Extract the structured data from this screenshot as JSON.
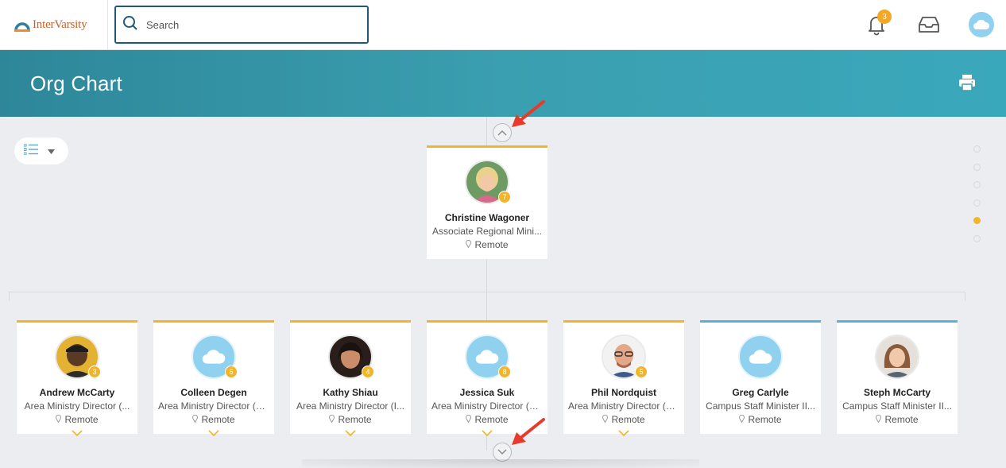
{
  "app": {
    "brand": "InterVarsity",
    "search": {
      "placeholder": "Search",
      "value": ""
    },
    "notifications": {
      "count": "3"
    }
  },
  "page": {
    "title": "Org Chart"
  },
  "manager": {
    "name": "Christine Wagoner",
    "title": "Associate Regional Mini...",
    "location": "Remote",
    "reports": "7"
  },
  "reports": [
    {
      "name": "Andrew McCarty",
      "title": "Area Ministry Director (...",
      "location": "Remote",
      "reports": "3"
    },
    {
      "name": "Colleen Degen",
      "title": "Area Ministry Director (S...",
      "location": "Remote",
      "reports": "6"
    },
    {
      "name": "Kathy Shiau",
      "title": "Area Ministry Director (I...",
      "location": "Remote",
      "reports": "4"
    },
    {
      "name": "Jessica Suk",
      "title": "Area Ministry Director (C...",
      "location": "Remote",
      "reports": "8"
    },
    {
      "name": "Phil Nordquist",
      "title": "Area Ministry Director (S...",
      "location": "Remote",
      "reports": "5"
    },
    {
      "name": "Greg Carlyle",
      "title": "Campus Staff Minister II...",
      "location": "Remote",
      "reports": ""
    },
    {
      "name": "Steph McCarty",
      "title": "Campus Staff Minister II...",
      "location": "Remote",
      "reports": ""
    }
  ],
  "colors": {
    "accent": "#f1b52a",
    "header": "#3a9fb0",
    "brand": "#c8612a",
    "search_border": "#1f5a7c",
    "annotation_arrow": "#e8392b"
  },
  "icons": [
    "search-icon",
    "bell-icon",
    "inbox-icon",
    "cloud-icon",
    "print-icon",
    "list-view-icon",
    "caret-down-icon",
    "chevron-up-icon",
    "chevron-down-icon",
    "location-pin-icon"
  ]
}
